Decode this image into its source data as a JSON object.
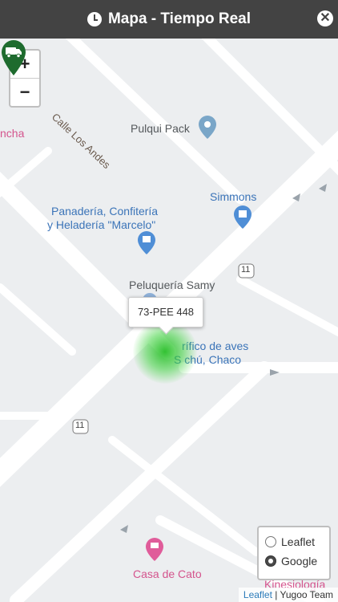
{
  "header": {
    "title": "Mapa - Tiempo Real",
    "icon": "clock-icon",
    "close_icon": "close-icon"
  },
  "zoom": {
    "in_label": "+",
    "out_label": "−"
  },
  "map": {
    "street_label": "Calle Los Andes",
    "route_badges": [
      "11",
      "11"
    ],
    "places": {
      "pulqui": "Pulqui Pack",
      "simmons": "Simmons",
      "panaderia_line1": "Panadería, Confitería",
      "panaderia_line2": "y Heladería \"Marcelo\"",
      "peluqueria": "Peluquería Samy",
      "frigorifico_line1": "rífico de aves",
      "frigorifico_line2": "S  chú, Chaco",
      "casa_cato": "Casa de Cato",
      "kinesiologia": "Kinesiología",
      "cut_left": "ncha"
    }
  },
  "vehicle": {
    "plate": "73-PEE 448",
    "icon": "truck-icon",
    "marker_color": "#1e6b2e"
  },
  "layers": {
    "options": [
      "Leaflet",
      "Google"
    ],
    "selected": "Google"
  },
  "attribution": {
    "link": "Leaflet",
    "sep": " | ",
    "team": "Yugoo Team"
  }
}
